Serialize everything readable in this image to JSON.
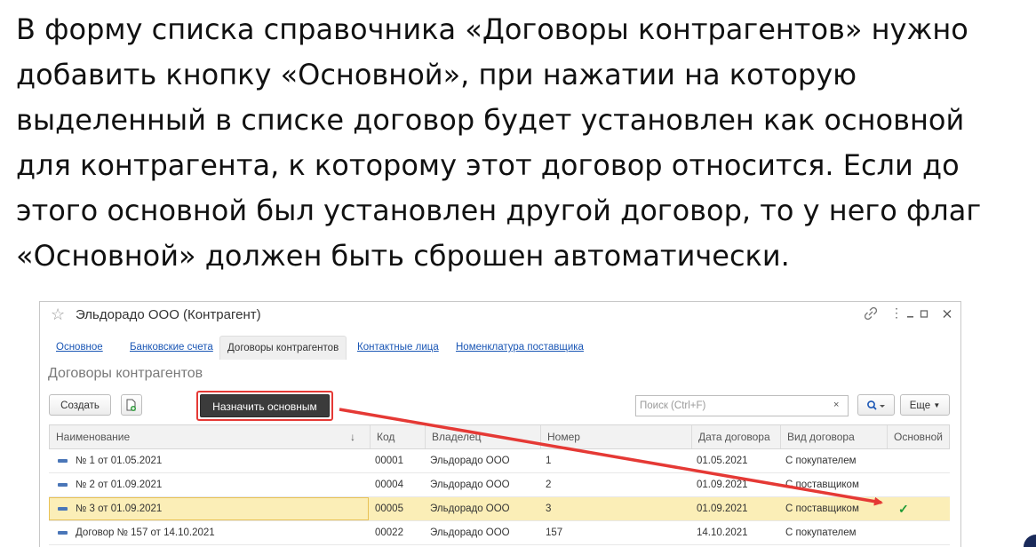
{
  "task_text": {
    "lines": [
      "В форму списка справочника «Договоры контрагентов» нужно",
      "добавить кнопку «Основной», при нажатии на которую",
      "выделенный в списке договор будет установлен как основной",
      "для контрагента, к которому этот договор относится. Если до",
      "этого основной был установлен другой договор, то у него флаг",
      "«Основной» должен быть сброшен автоматически."
    ]
  },
  "window": {
    "title": "Эльдорадо ООО (Контрагент)",
    "icons": [
      "star-icon",
      "link-icon",
      "more-icon",
      "minimize-icon",
      "maximize-icon",
      "close-icon"
    ]
  },
  "tabs": [
    {
      "label": "Основное",
      "active": false
    },
    {
      "label": "Банковские счета",
      "active": false
    },
    {
      "label": "Договоры контрагентов",
      "active": true
    },
    {
      "label": "Контактные лица",
      "active": false
    },
    {
      "label": "Номенклатура поставщика",
      "active": false
    }
  ],
  "section_title": "Договоры контрагентов",
  "toolbar": {
    "create_label": "Создать",
    "assign_main_label": "Назначить основным",
    "search_placeholder": "Поиск (Ctrl+F)",
    "search_value": "",
    "clear_symbol": "×",
    "more_label": "Еще"
  },
  "table": {
    "columns": [
      "Наименование",
      "Код",
      "Владелец",
      "Номер",
      "Дата договора",
      "Вид договора",
      "Основной"
    ],
    "sort_symbol": "↓",
    "rows": [
      {
        "name": "№ 1 от 01.05.2021",
        "code": "00001",
        "owner": "Эльдорадо ООО",
        "number": "1",
        "date": "01.05.2021",
        "kind": "С покупателем",
        "main": ""
      },
      {
        "name": "№ 2 от 01.09.2021",
        "code": "00004",
        "owner": "Эльдорадо ООО",
        "number": "2",
        "date": "01.09.2021",
        "kind": "С поставщиком",
        "main": ""
      },
      {
        "name": "№ 3 от 01.09.2021",
        "code": "00005",
        "owner": "Эльдорадо ООО",
        "number": "3",
        "date": "01.09.2021",
        "kind": "С поставщиком",
        "main": "✓"
      },
      {
        "name": "Договор № 157 от 14.10.2021",
        "code": "00022",
        "owner": "Эльдорадо ООО",
        "number": "157",
        "date": "14.10.2021",
        "kind": "С покупателем",
        "main": ""
      }
    ],
    "selected_row": 2
  },
  "colors": {
    "accent_red": "#e53935",
    "selected_row": "#fbeeb7",
    "check_green": "#1e9a36",
    "link_blue": "#1a56b5",
    "dark_button": "#3b3b3b"
  }
}
